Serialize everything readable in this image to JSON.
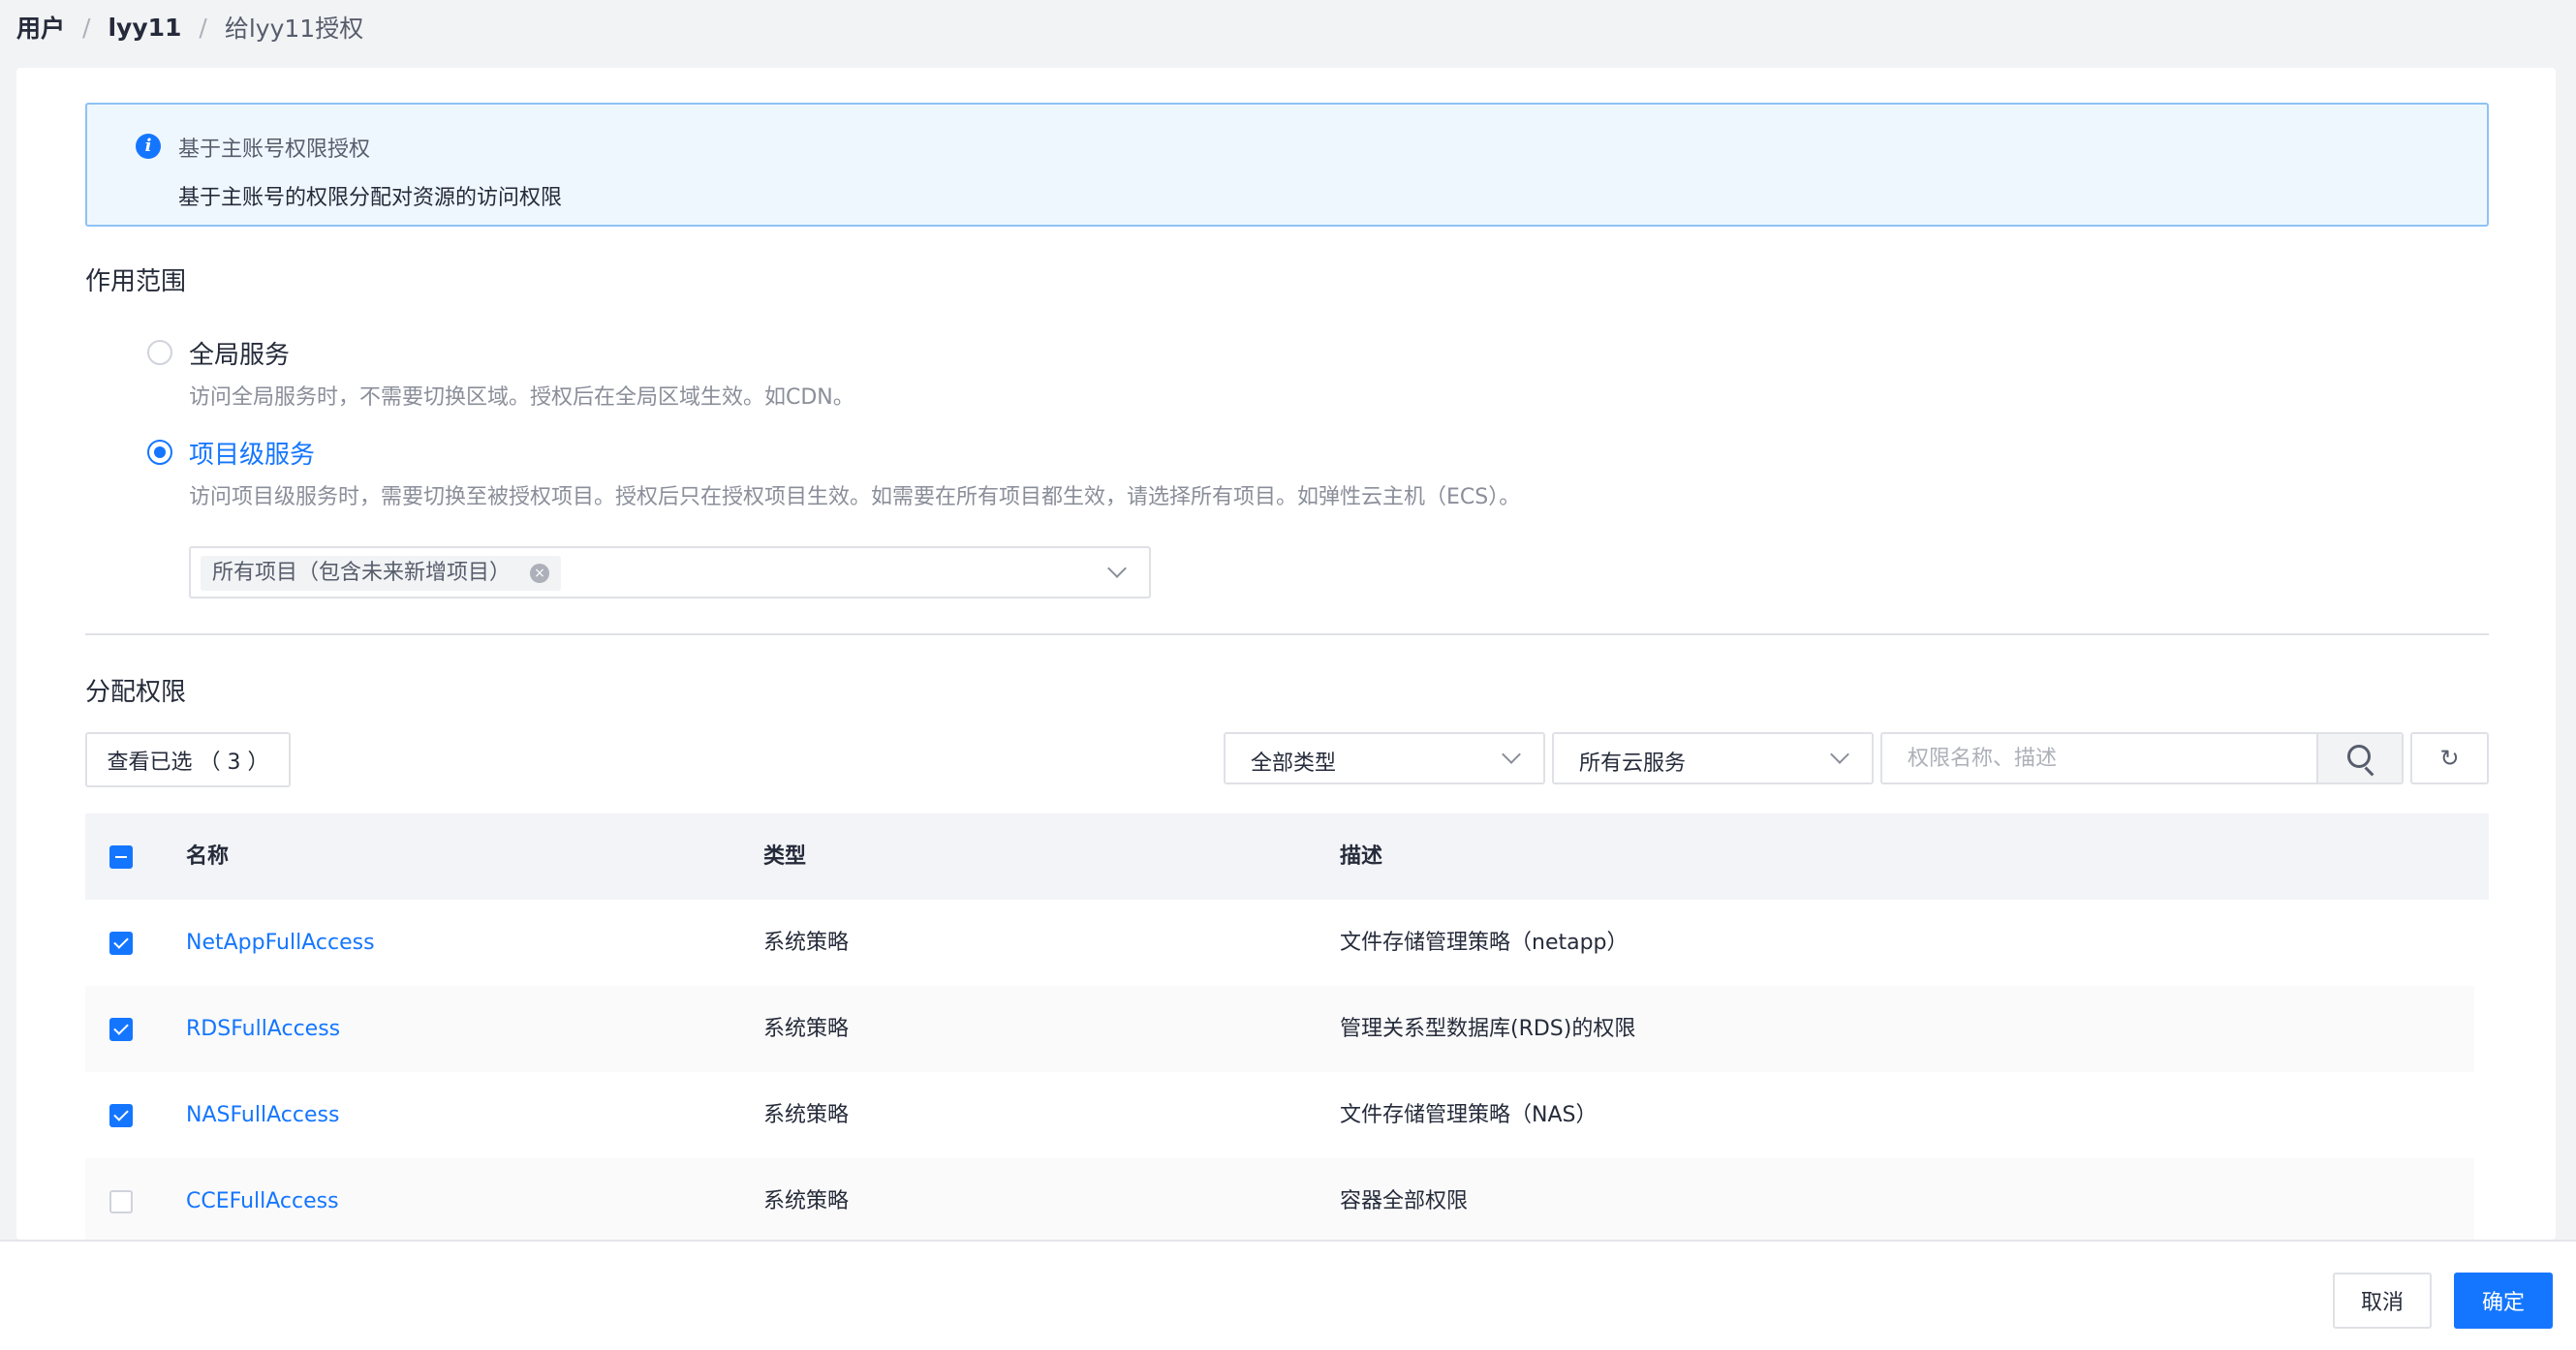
{
  "breadcrumb": {
    "root": "用户",
    "user": "lyy11",
    "separator": "/",
    "current": "给lyy11授权"
  },
  "info": {
    "title": "基于主账号权限授权",
    "description": "基于主账号的权限分配对资源的访问权限"
  },
  "scope": {
    "title": "作用范围",
    "options": [
      {
        "label": "全局服务",
        "description": "访问全局服务时，不需要切换区域。授权后在全局区域生效。如CDN。",
        "selected": false
      },
      {
        "label": "项目级服务",
        "description": "访问项目级服务时，需要切换至被授权项目。授权后只在授权项目生效。如需要在所有项目都生效，请选择所有项目。如弹性云主机（ECS）。",
        "selected": true
      }
    ],
    "project_tag": "所有项目（包含未来新增项目）",
    "tag_close_glyph": "×"
  },
  "permissions": {
    "title": "分配权限",
    "view_selected": "查看已选 （ 3 ）",
    "type_filter": "全部类型",
    "service_filter": "所有云服务",
    "search_placeholder": "权限名称、描述",
    "refresh_glyph": "↻",
    "columns": {
      "name": "名称",
      "type": "类型",
      "description": "描述"
    },
    "rows": [
      {
        "name": "NetAppFullAccess",
        "type": "系统策略",
        "description": "文件存储管理策略（netapp）",
        "checked": true
      },
      {
        "name": "RDSFullAccess",
        "type": "系统策略",
        "description": "管理关系型数据库(RDS)的权限",
        "checked": true
      },
      {
        "name": "NASFullAccess",
        "type": "系统策略",
        "description": "文件存储管理策略（NAS）",
        "checked": true
      },
      {
        "name": "CCEFullAccess",
        "type": "系统策略",
        "description": "容器全部权限",
        "checked": false
      }
    ]
  },
  "footer": {
    "cancel": "取消",
    "confirm": "确定"
  },
  "colors": {
    "primary": "#1476ff",
    "info_bg": "#eff7fe",
    "info_border": "#8ec2f5"
  }
}
